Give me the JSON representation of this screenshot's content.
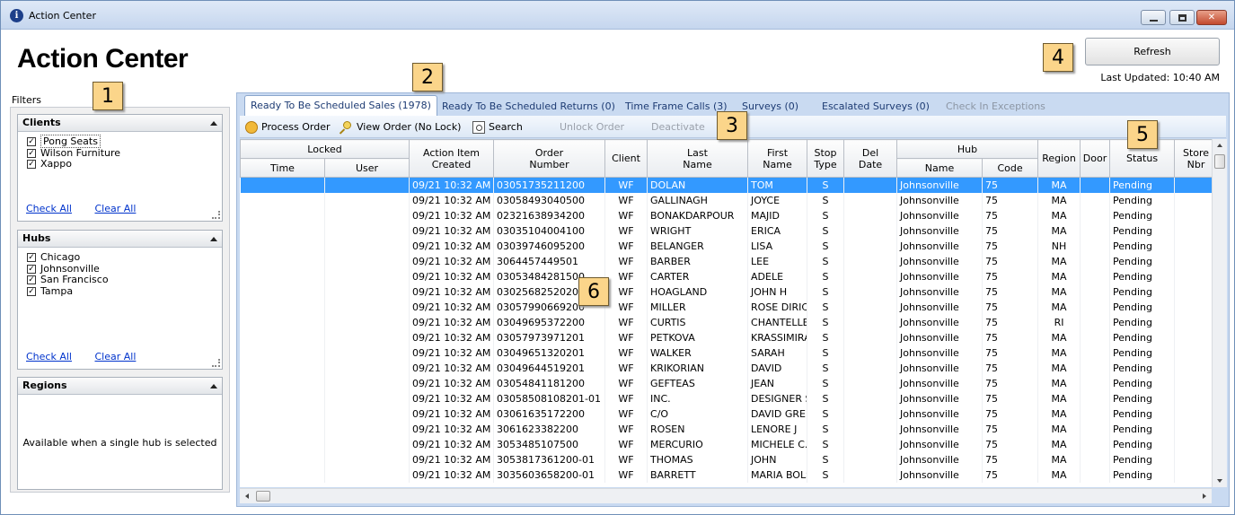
{
  "window": {
    "title": "Action Center"
  },
  "app_title": "Action Center",
  "refresh": {
    "label": "Refresh",
    "last_updated": "Last Updated: 10:40 AM"
  },
  "filters": {
    "label": "Filters",
    "clients": {
      "title": "Clients",
      "items": [
        "Pong Seats",
        "Wilson Furniture",
        "Xappo"
      ],
      "check_all": "Check All",
      "clear_all": "Clear All"
    },
    "hubs": {
      "title": "Hubs",
      "items": [
        "Chicago",
        "Johnsonville",
        "San Francisco",
        "Tampa"
      ],
      "check_all": "Check All",
      "clear_all": "Clear All"
    },
    "regions": {
      "title": "Regions",
      "note": "Available when a single hub is selected"
    }
  },
  "tabs": [
    {
      "label": "Ready To Be Scheduled Sales (1978)",
      "state": "active"
    },
    {
      "label": "Ready To Be Scheduled Returns (0)",
      "state": "normal"
    },
    {
      "label": "Time Frame Calls (3)",
      "state": "normal"
    },
    {
      "label": "Surveys (0)",
      "state": "normal"
    },
    {
      "label": "Escalated Surveys (0)",
      "state": "normal"
    },
    {
      "label": "Check In Exceptions",
      "state": "disabled"
    }
  ],
  "toolbar": {
    "process_order": "Process Order",
    "view_order": "View Order (No Lock)",
    "search": "Search",
    "unlock_order": "Unlock Order",
    "deactivate": "Deactivate"
  },
  "callouts": [
    "1",
    "2",
    "3",
    "4",
    "5",
    "6"
  ],
  "table": {
    "group_locked": "Locked",
    "group_hub": "Hub",
    "headers": {
      "time": "Time",
      "user": "User",
      "created": [
        "Action Item",
        "Created"
      ],
      "order": [
        "Order",
        "Number"
      ],
      "client": "Client",
      "last": [
        "Last",
        "Name"
      ],
      "first": [
        "First",
        "Name"
      ],
      "stop": [
        "Stop",
        "Type"
      ],
      "del": [
        "Del",
        "Date"
      ],
      "hub_name": "Name",
      "hub_code": "Code",
      "region": "Region",
      "door": "Door",
      "status": "Status",
      "store": [
        "Store",
        "Nbr"
      ]
    },
    "rows": [
      [
        "09/21 10:32 AM",
        "03051735211200",
        "WF",
        "DOLAN",
        "TOM",
        "S",
        "Johnsonville",
        "75",
        "MA",
        "Pending"
      ],
      [
        "09/21 10:32 AM",
        "03058493040500",
        "WF",
        "GALLINAGH",
        "JOYCE",
        "S",
        "Johnsonville",
        "75",
        "MA",
        "Pending"
      ],
      [
        "09/21 10:32 AM",
        "02321638934200",
        "WF",
        "BONAKDARPOUR",
        "MAJID",
        "S",
        "Johnsonville",
        "75",
        "MA",
        "Pending"
      ],
      [
        "09/21 10:32 AM",
        "03035104004100",
        "WF",
        "WRIGHT",
        "ERICA",
        "S",
        "Johnsonville",
        "75",
        "MA",
        "Pending"
      ],
      [
        "09/21 10:32 AM",
        "03039746095200",
        "WF",
        "BELANGER",
        "LISA",
        "S",
        "Johnsonville",
        "75",
        "NH",
        "Pending"
      ],
      [
        "09/21 10:32 AM",
        "3064457449501",
        "WF",
        "BARBER",
        "LEE",
        "S",
        "Johnsonville",
        "75",
        "MA",
        "Pending"
      ],
      [
        "09/21 10:32 AM",
        "03053484281500",
        "WF",
        "CARTER",
        "ADELE",
        "S",
        "Johnsonville",
        "75",
        "MA",
        "Pending"
      ],
      [
        "09/21 10:32 AM",
        "03025682520201",
        "WF",
        "HOAGLAND",
        "JOHN H",
        "S",
        "Johnsonville",
        "75",
        "MA",
        "Pending"
      ],
      [
        "09/21 10:32 AM",
        "03057990669200",
        "WF",
        "MILLER",
        "ROSE DIRICO",
        "S",
        "Johnsonville",
        "75",
        "MA",
        "Pending"
      ],
      [
        "09/21 10:32 AM",
        "03049695372200",
        "WF",
        "CURTIS",
        "CHANTELLE",
        "S",
        "Johnsonville",
        "75",
        "RI",
        "Pending"
      ],
      [
        "09/21 10:32 AM",
        "03057973971201",
        "WF",
        "PETKOVA",
        "KRASSIMIRA",
        "S",
        "Johnsonville",
        "75",
        "MA",
        "Pending"
      ],
      [
        "09/21 10:32 AM",
        "03049651320201",
        "WF",
        "WALKER",
        "SARAH",
        "S",
        "Johnsonville",
        "75",
        "MA",
        "Pending"
      ],
      [
        "09/21 10:32 AM",
        "03049644519201",
        "WF",
        "KRIKORIAN",
        "DAVID",
        "S",
        "Johnsonville",
        "75",
        "MA",
        "Pending"
      ],
      [
        "09/21 10:32 AM",
        "03054841181200",
        "WF",
        "GEFTEAS",
        "JEAN",
        "S",
        "Johnsonville",
        "75",
        "MA",
        "Pending"
      ],
      [
        "09/21 10:32 AM",
        "03058508108201-01",
        "WF",
        "INC.",
        "DESIGNER SE",
        "S",
        "Johnsonville",
        "75",
        "MA",
        "Pending"
      ],
      [
        "09/21 10:32 AM",
        "03061635172200",
        "WF",
        "C/O",
        "DAVID GREEN",
        "S",
        "Johnsonville",
        "75",
        "MA",
        "Pending"
      ],
      [
        "09/21 10:32 AM",
        "3061623382200",
        "WF",
        "ROSEN",
        "LENORE J",
        "S",
        "Johnsonville",
        "75",
        "MA",
        "Pending"
      ],
      [
        "09/21 10:32 AM",
        "3053485107500",
        "WF",
        "MERCURIO",
        "MICHELE C.",
        "S",
        "Johnsonville",
        "75",
        "MA",
        "Pending"
      ],
      [
        "09/21 10:32 AM",
        "3053817361200-01",
        "WF",
        "THOMAS",
        "JOHN",
        "S",
        "Johnsonville",
        "75",
        "MA",
        "Pending"
      ],
      [
        "09/21 10:32 AM",
        "3035603658200-01",
        "WF",
        "BARRETT",
        "MARIA BOLST",
        "S",
        "Johnsonville",
        "75",
        "MA",
        "Pending"
      ]
    ]
  }
}
